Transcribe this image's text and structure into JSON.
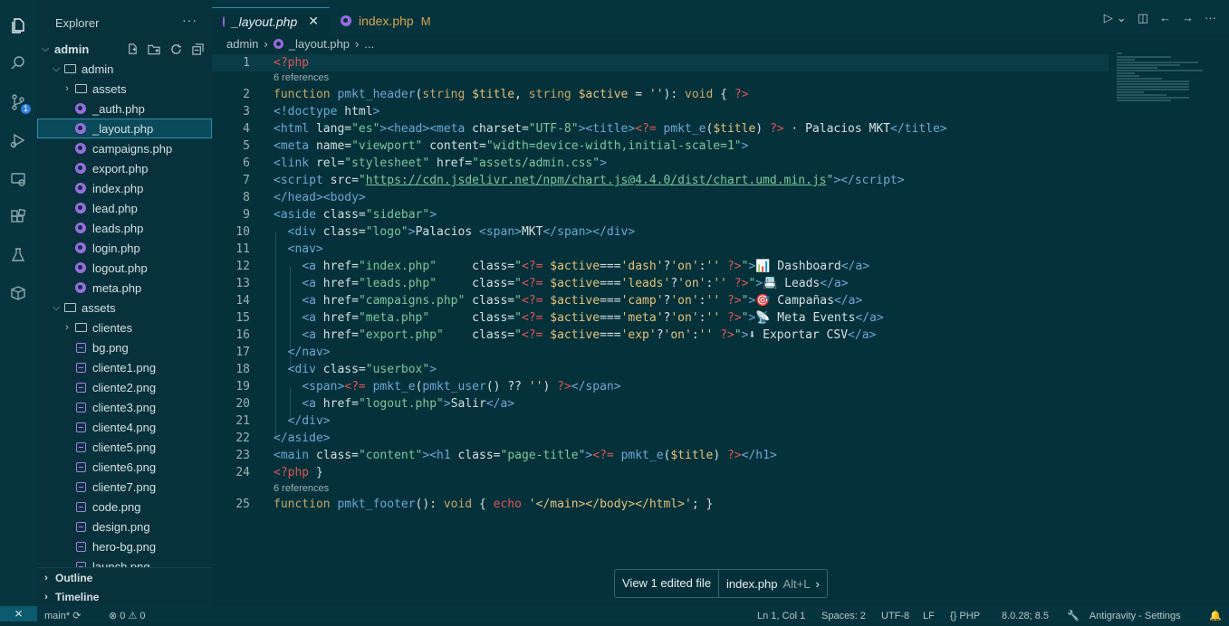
{
  "activity_bar": {
    "items": [
      {
        "name": "explorer-icon",
        "active": true
      },
      {
        "name": "search-icon"
      },
      {
        "name": "source-control-icon",
        "badge": "1"
      },
      {
        "name": "run-debug-icon"
      },
      {
        "name": "remote-explorer-icon"
      },
      {
        "name": "extensions-icon"
      },
      {
        "name": "testing-icon"
      },
      {
        "name": "containers-icon"
      }
    ]
  },
  "sidebar": {
    "title": "Explorer",
    "more": "···",
    "root_folder": "admin",
    "tree": [
      {
        "label": "admin",
        "type": "folder",
        "depth": 1,
        "expanded": true
      },
      {
        "label": "assets",
        "type": "folder-special",
        "depth": 2,
        "expanded": false
      },
      {
        "label": "_auth.php",
        "type": "php",
        "depth": 2
      },
      {
        "label": "_layout.php",
        "type": "php",
        "depth": 2,
        "selected": true
      },
      {
        "label": "campaigns.php",
        "type": "php",
        "depth": 2
      },
      {
        "label": "export.php",
        "type": "php",
        "depth": 2
      },
      {
        "label": "index.php",
        "type": "php",
        "depth": 2
      },
      {
        "label": "lead.php",
        "type": "php",
        "depth": 2
      },
      {
        "label": "leads.php",
        "type": "php",
        "depth": 2
      },
      {
        "label": "login.php",
        "type": "php",
        "depth": 2
      },
      {
        "label": "logout.php",
        "type": "php",
        "depth": 2
      },
      {
        "label": "meta.php",
        "type": "php",
        "depth": 2
      },
      {
        "label": "assets",
        "type": "folder-special",
        "depth": 1,
        "expanded": true
      },
      {
        "label": "clientes",
        "type": "folder",
        "depth": 2,
        "expanded": false
      },
      {
        "label": "bg.png",
        "type": "image",
        "depth": 2
      },
      {
        "label": "cliente1.png",
        "type": "image",
        "depth": 2
      },
      {
        "label": "cliente2.png",
        "type": "image",
        "depth": 2
      },
      {
        "label": "cliente3.png",
        "type": "image",
        "depth": 2
      },
      {
        "label": "cliente4.png",
        "type": "image",
        "depth": 2
      },
      {
        "label": "cliente5.png",
        "type": "image",
        "depth": 2
      },
      {
        "label": "cliente6.png",
        "type": "image",
        "depth": 2
      },
      {
        "label": "cliente7.png",
        "type": "image",
        "depth": 2
      },
      {
        "label": "code.png",
        "type": "image",
        "depth": 2
      },
      {
        "label": "design.png",
        "type": "image",
        "depth": 2
      },
      {
        "label": "hero-bg.png",
        "type": "image",
        "depth": 2
      },
      {
        "label": "launch.png",
        "type": "image",
        "depth": 2
      }
    ],
    "sections": [
      "Outline",
      "Timeline"
    ]
  },
  "tabs": [
    {
      "label": "_layout.php",
      "active": true,
      "close": "✕"
    },
    {
      "label": "index.php",
      "active": false,
      "modified": "M"
    }
  ],
  "breadcrumb": [
    "admin",
    "_layout.php",
    "..."
  ],
  "code": {
    "references_label": "6 references",
    "line_numbers": [
      "1",
      "2",
      "3",
      "4",
      "5",
      "6",
      "7",
      "8",
      "9",
      "10",
      "11",
      "12",
      "13",
      "14",
      "15",
      "16",
      "17",
      "18",
      "19",
      "20",
      "21",
      "22",
      "23",
      "24",
      "25"
    ]
  },
  "popup": {
    "left": "View 1 edited file",
    "file": "index.php",
    "shortcut": "Alt+L"
  },
  "statusbar": {
    "branch": "main*",
    "errors": "0",
    "warnings": "0",
    "position": "Ln 1, Col 1",
    "spaces": "Spaces: 2",
    "encoding": "UTF-8",
    "eol": "LF",
    "language": "PHP",
    "php_version": "8.0.28; 8.5",
    "settings": "Antigravity - Settings"
  }
}
